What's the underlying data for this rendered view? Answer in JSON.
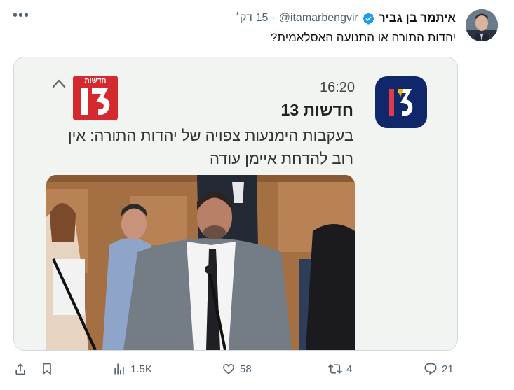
{
  "tweet": {
    "display_name": "איתמר בן גביר",
    "handle": "@itamarbengvir",
    "separator": "·",
    "time": "15 דק׳",
    "text": "יהדות התורה או התנועה האסלאמית?",
    "more_icon": "more-horizontal-icon",
    "verified_color": "#1d9bf0"
  },
  "card": {
    "notification": {
      "app_logo_text": "13",
      "time": "16:20",
      "source": "חדשות 13",
      "headline": "בעקבות הימנעות צפויה של יהדות התורה: אין רוב להדחת איימן עודה",
      "small_logo_label": "חדשות",
      "small_logo_number": "13"
    }
  },
  "actions": {
    "share_icon": "share-icon",
    "bookmark_icon": "bookmark-icon",
    "views": "1.5K",
    "likes": "58",
    "retweets": "4",
    "replies": "21"
  }
}
